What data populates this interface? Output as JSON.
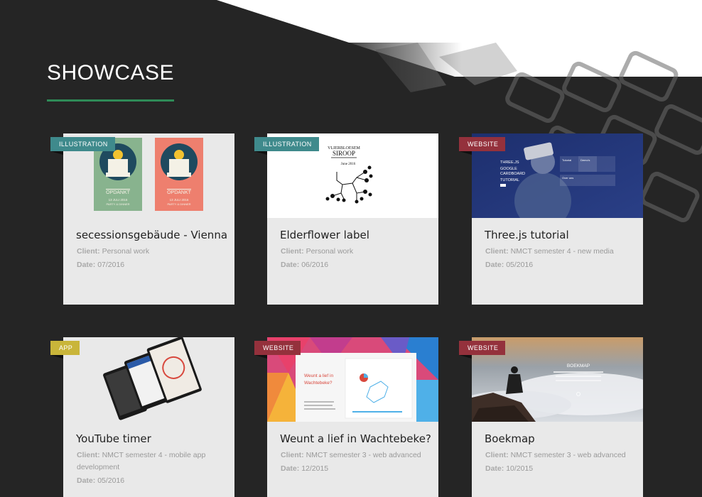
{
  "section": {
    "title": "SHOWCASE"
  },
  "colors": {
    "accent_rule": "#2e8b57",
    "illustration_tag": "#3f8a8c",
    "website_tag": "#94313c",
    "app_tag": "#c9b53a",
    "card_bg": "#e9e9e9",
    "page_bg": "#252525"
  },
  "projects": [
    {
      "tag": "ILLUSTRATION",
      "title": "secessionsgebäude - Vienna",
      "client_label": "Client:",
      "client": "Personal work",
      "date_label": "Date:",
      "date": "07/2016",
      "poster_text": "OPDANKT",
      "poster_sub1": "13 JULI 2016",
      "poster_sub2": "PARTY & DINNER"
    },
    {
      "tag": "ILLUSTRATION",
      "title": "Elderflower label",
      "client_label": "Client:",
      "client": "Personal work",
      "date_label": "Date:",
      "date": "06/2016",
      "label_line1": "VLIERBLOESEM",
      "label_line2": "SIROOP",
      "label_line3": "June 2016"
    },
    {
      "tag": "WEBSITE",
      "title": "Three.js tutorial",
      "client_label": "Client:",
      "client": "NMCT semester 4 - new media",
      "date_label": "Date:",
      "date": "05/2016",
      "thumb_lines": [
        "THREE.JS",
        "GOOGLE",
        "CARDBOARD",
        "TUTORIAL"
      ],
      "thumb_tab1": "Tutorial",
      "thumb_tab2": "Demo's",
      "thumb_tab3": "Over ons"
    },
    {
      "tag": "APP",
      "title": "YouTube timer",
      "client_label": "Client:",
      "client": "NMCT semester 4 - mobile app development",
      "date_label": "Date:",
      "date": "05/2016"
    },
    {
      "tag": "WEBSITE",
      "title": "Weunt a lief in Wachtebeke?",
      "client_label": "Client:",
      "client": "NMCT semester 3 - web advanced",
      "date_label": "Date:",
      "date": "12/2015",
      "thumb_heading1": "Weunt a lief in",
      "thumb_heading2": "Wachtebeke?"
    },
    {
      "tag": "WEBSITE",
      "title": "Boekmap",
      "client_label": "Client:",
      "client": "NMCT semester 3 - web advanced",
      "date_label": "Date:",
      "date": "10/2015",
      "thumb_heading": "BOEKMAP"
    }
  ]
}
